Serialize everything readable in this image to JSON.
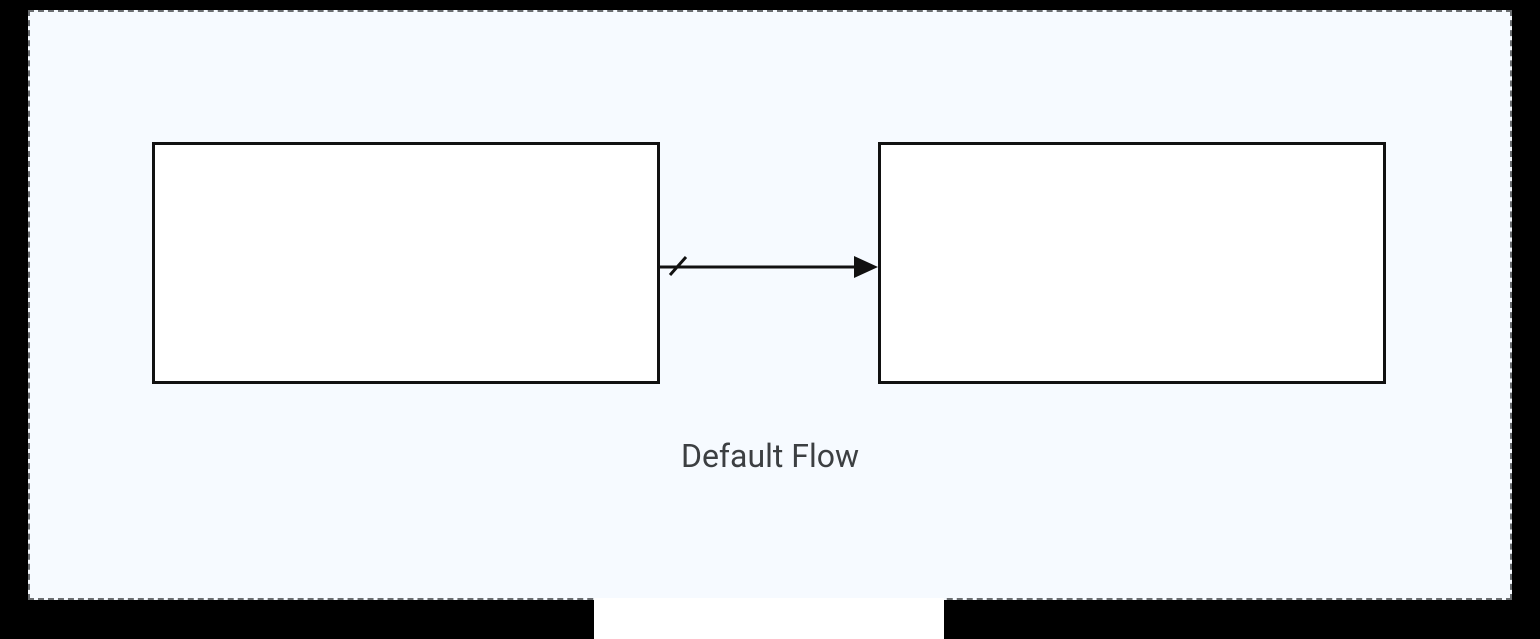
{
  "diagram": {
    "caption": "Default Flow",
    "nodes": {
      "a": {
        "label": ""
      },
      "b": {
        "label": ""
      }
    },
    "connector": {
      "type": "default-flow",
      "from": "a",
      "to": "b"
    }
  }
}
